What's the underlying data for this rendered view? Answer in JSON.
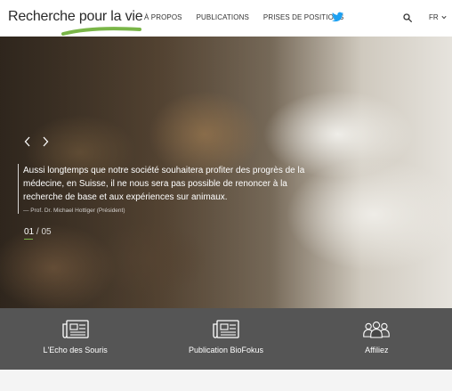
{
  "header": {
    "logo_text": "Recherche pour la vie",
    "nav": [
      "À PROPOS",
      "PUBLICATIONS",
      "PRISES DE POSITIONS"
    ],
    "lang": "FR"
  },
  "icons": {
    "twitter": "twitter-icon",
    "search": "search-icon",
    "lang_caret": "chevron-down-icon",
    "prev": "chevron-left-icon",
    "next": "chevron-right-icon",
    "feature1": "newspaper-icon",
    "feature2": "newspaper-icon",
    "feature3": "users-icon"
  },
  "colors": {
    "accent_green": "#7ab648",
    "twitter_blue": "#1da1f2",
    "feature_bar": "#464646"
  },
  "hero": {
    "quote": "Aussi longtemps que notre société souhaitera profiter des progrès de la médecine, en Suisse, il ne nous sera pas possible de renoncer à la recherche de base et aux expériences sur animaux.",
    "author": "— Prof. Dr. Michael Hottiger (Président)",
    "current": "01",
    "separator": " / ",
    "total": "05"
  },
  "features": [
    {
      "label": "L'Echo des Souris"
    },
    {
      "label": "Publication BioFokus"
    },
    {
      "label": "Affiliez"
    }
  ]
}
